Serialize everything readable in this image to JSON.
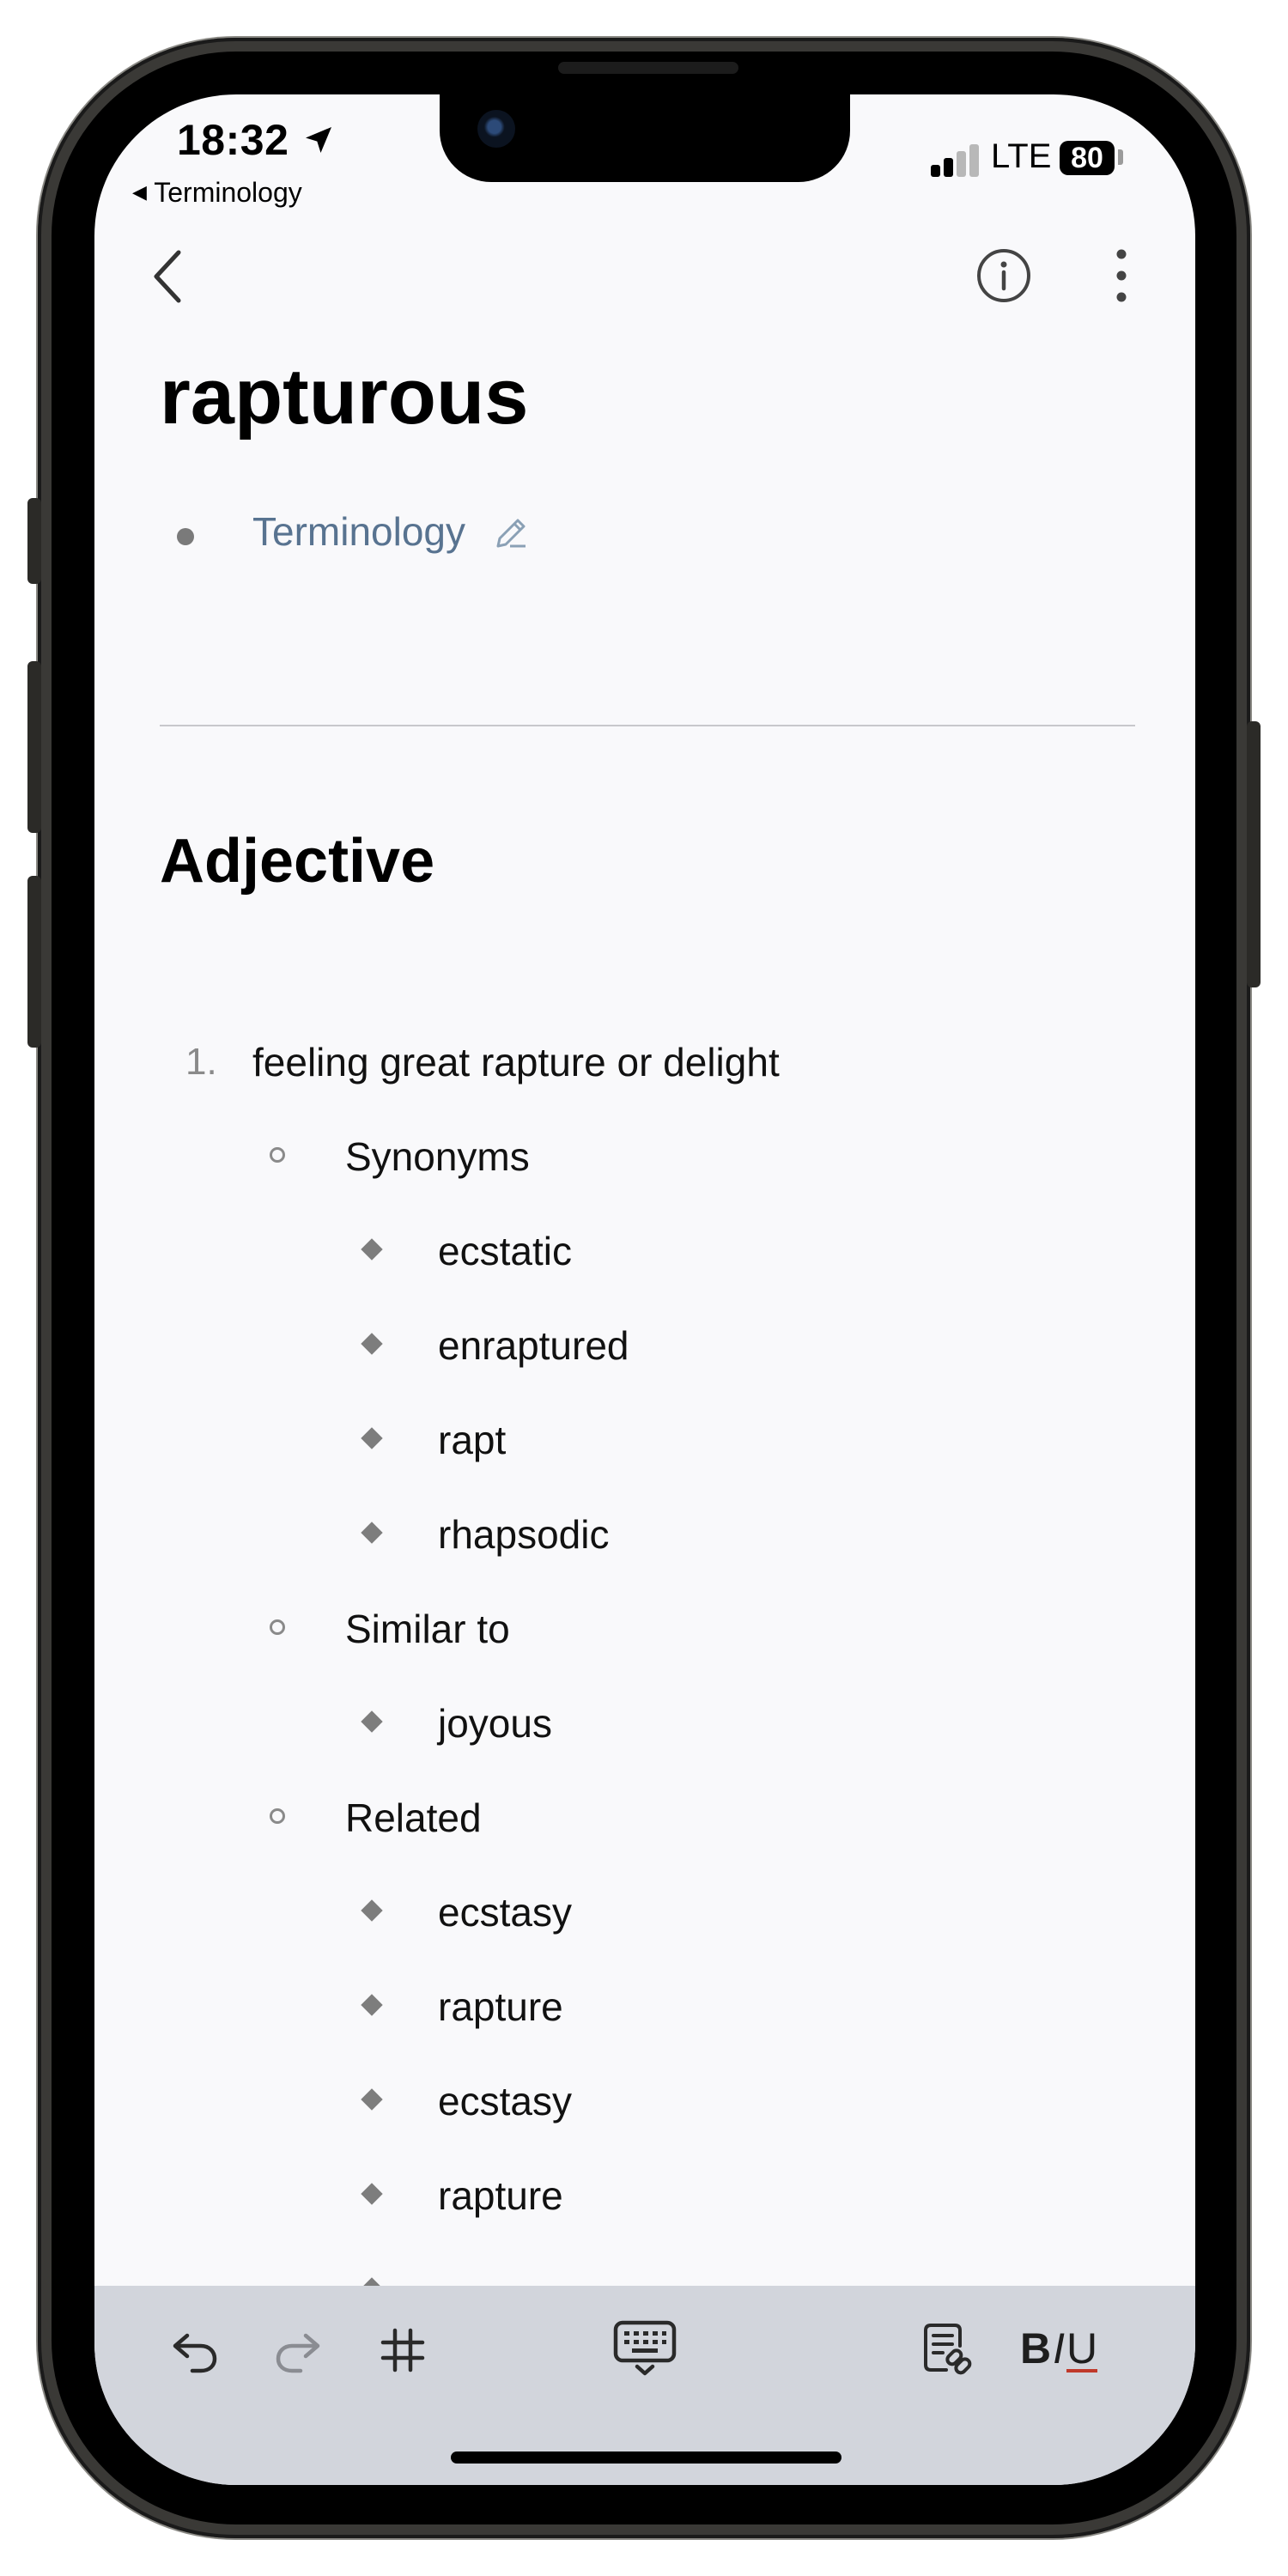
{
  "status_bar": {
    "time": "18:32",
    "back_app": "Terminology",
    "network": "LTE",
    "battery": "80"
  },
  "entry": {
    "title": "rapturous",
    "tag": "Terminology",
    "part_of_speech": "Adjective",
    "definition_number": "1.",
    "definition": "feeling great rapture or delight",
    "groups": [
      {
        "label": "Synonyms",
        "items": [
          "ecstatic",
          "enraptured",
          "rapt",
          "rhapsodic"
        ]
      },
      {
        "label": "Similar to",
        "items": [
          "joyous"
        ]
      },
      {
        "label": "Related",
        "items": [
          "ecstasy",
          "rapture",
          "ecstasy",
          "rapture"
        ]
      }
    ]
  },
  "toolbar": {
    "format_bold": "B",
    "format_italic": "I",
    "format_underline": "U"
  },
  "icons": {
    "nav": [
      "back-chevron-icon",
      "info-icon",
      "more-vertical-icon"
    ],
    "toolbar": [
      "undo-icon",
      "redo-icon",
      "table-grid-icon",
      "keyboard-icon",
      "note-link-icon"
    ]
  }
}
